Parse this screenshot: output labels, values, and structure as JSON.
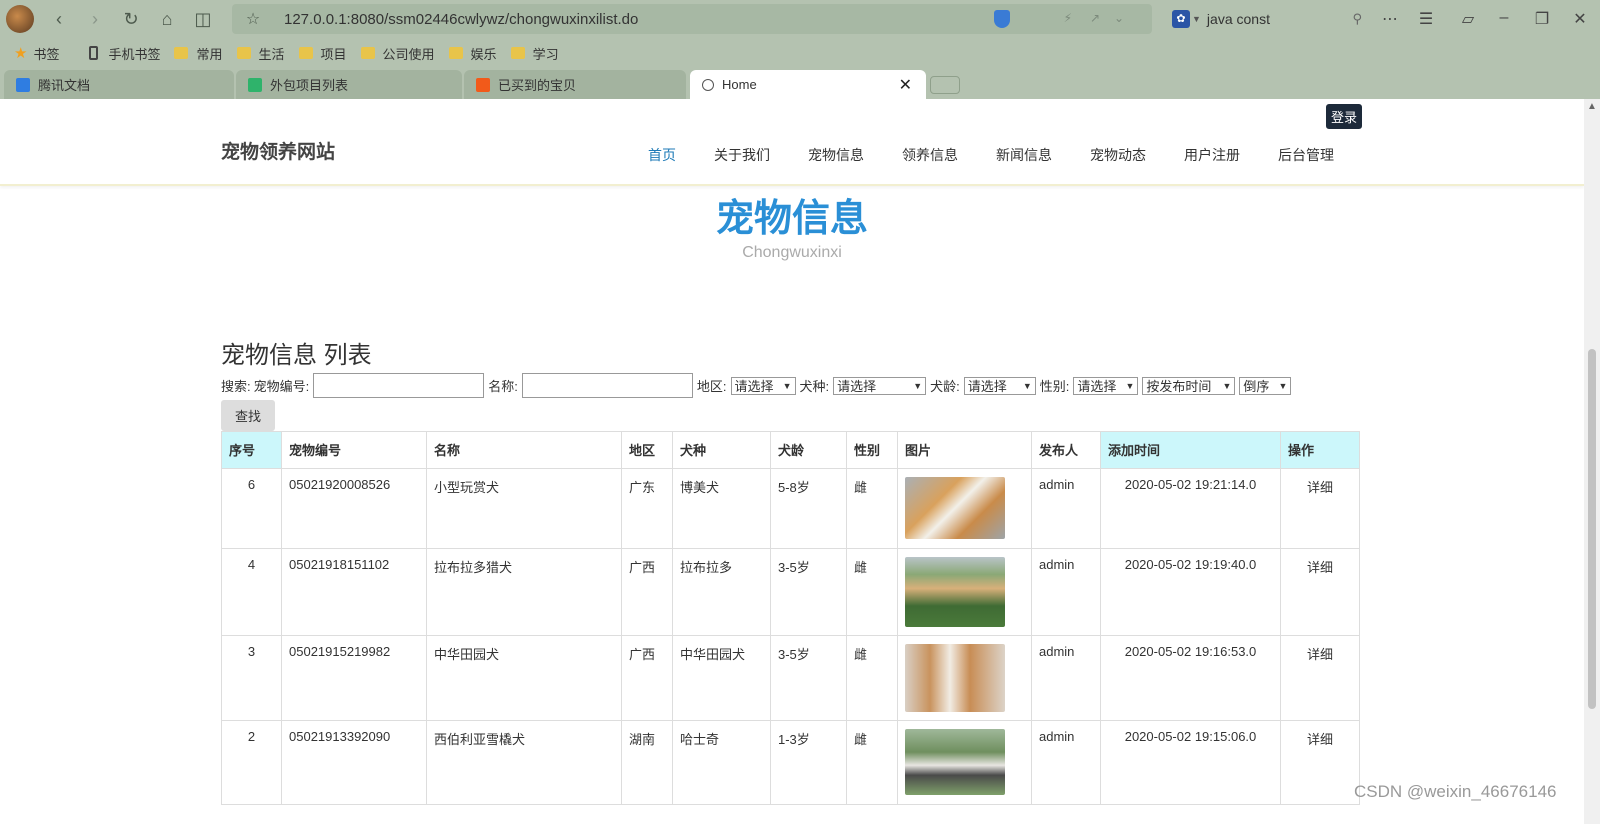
{
  "browser": {
    "url": "127.0.0.1:8080/ssm02446cwlywz/chongwuxinxilist.do",
    "search_query": "java const"
  },
  "bookmarks": [
    "书签",
    "手机书签",
    "常用",
    "生活",
    "项目",
    "公司使用",
    "娱乐",
    "学习"
  ],
  "tabs": [
    "腾讯文档",
    "外包项目列表",
    "已买到的宝贝",
    "Home"
  ],
  "site": {
    "login": "登录",
    "title": "宠物领养网站",
    "nav": [
      "首页",
      "关于我们",
      "宠物信息",
      "领养信息",
      "新闻信息",
      "宠物动态",
      "用户注册",
      "后台管理"
    ]
  },
  "hero": {
    "title": "宠物信息",
    "subtitle": "Chongwuxinxi"
  },
  "list_title": "宠物信息 列表",
  "search": {
    "label": "搜索:",
    "code_label": "宠物编号:",
    "name_label": "名称:",
    "region_label": "地区:",
    "breed_label": "犬种:",
    "age_label": "犬龄:",
    "gender_label": "性别:",
    "select_placeholder": "请选择",
    "sort_field": "按发布时间",
    "sort_order": "倒序",
    "find_button": "查找"
  },
  "table": {
    "headers": [
      "序号",
      "宠物编号",
      "名称",
      "地区",
      "犬种",
      "犬龄",
      "性别",
      "图片",
      "发布人",
      "添加时间",
      "操作"
    ],
    "rows": [
      {
        "idx": "6",
        "code": "05021920008526",
        "name": "小型玩赏犬",
        "region": "广东",
        "breed": "博美犬",
        "age": "5-8岁",
        "gender": "雌",
        "publisher": "admin",
        "time": "2020-05-02 19:21:14.0",
        "action": "详细"
      },
      {
        "idx": "4",
        "code": "05021918151102",
        "name": "拉布拉多猎犬",
        "region": "广西",
        "breed": "拉布拉多",
        "age": "3-5岁",
        "gender": "雌",
        "publisher": "admin",
        "time": "2020-05-02 19:19:40.0",
        "action": "详细"
      },
      {
        "idx": "3",
        "code": "05021915219982",
        "name": "中华田园犬",
        "region": "广西",
        "breed": "中华田园犬",
        "age": "3-5岁",
        "gender": "雌",
        "publisher": "admin",
        "time": "2020-05-02 19:16:53.0",
        "action": "详细"
      },
      {
        "idx": "2",
        "code": "05021913392090",
        "name": "西伯利亚雪橇犬",
        "region": "湖南",
        "breed": "哈士奇",
        "age": "1-3岁",
        "gender": "雌",
        "publisher": "admin",
        "time": "2020-05-02 19:15:06.0",
        "action": "详细"
      }
    ]
  },
  "watermark": "CSDN @weixin_46676146"
}
